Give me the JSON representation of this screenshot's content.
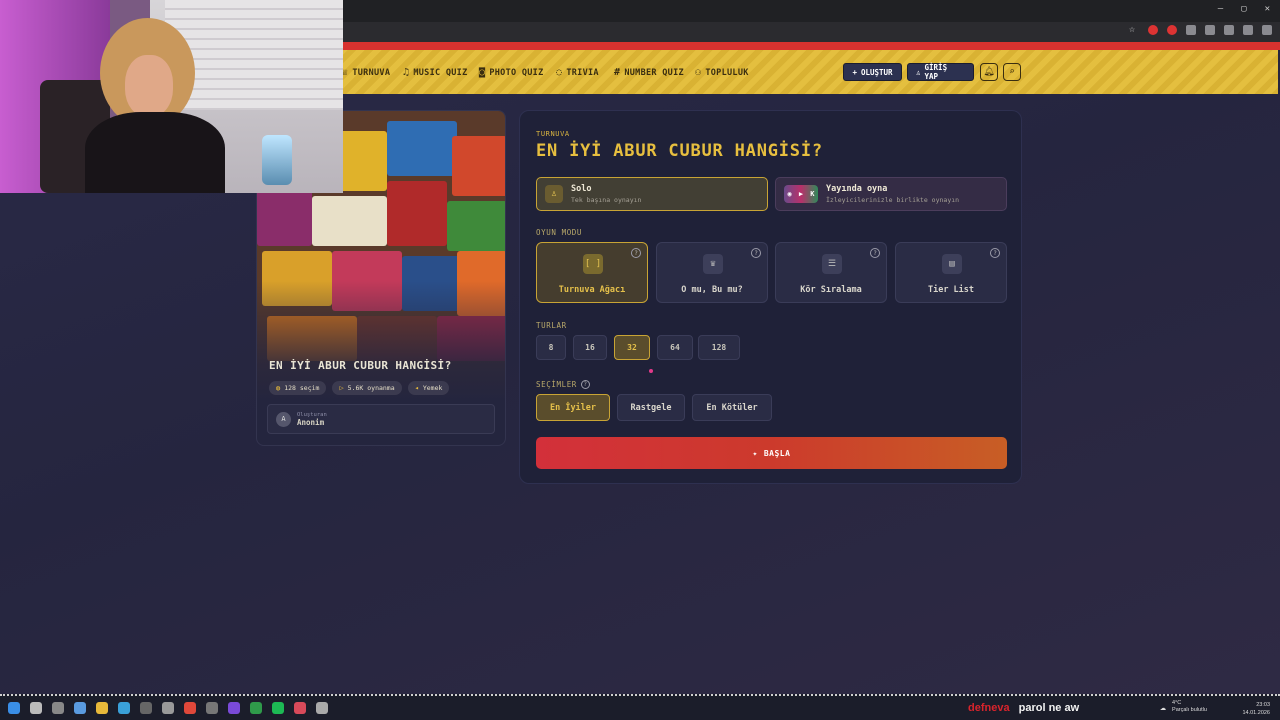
{
  "nav": {
    "items": [
      {
        "icon": "trophy-icon",
        "label": "TURNUVA"
      },
      {
        "icon": "music-icon",
        "label": "MUSIC QUIZ"
      },
      {
        "icon": "camera-icon",
        "label": "PHOTO QUIZ"
      },
      {
        "icon": "chat-icon",
        "label": "TRIVIA"
      },
      {
        "icon": "hash-icon",
        "label": "NUMBER QUIZ"
      },
      {
        "icon": "users-icon",
        "label": "TOPLULUK"
      }
    ],
    "create_label": "OLUŞTUR",
    "login_label": "GİRİŞ YAP"
  },
  "card": {
    "title": "EN İYİ ABUR CUBUR HANGİSİ?",
    "choices": "128 seçim",
    "plays": "5.6K oynanma",
    "category": "Yemek",
    "creator_label": "Oluşturan",
    "creator_initial": "A",
    "creator_name": "Anonim"
  },
  "panel": {
    "kicker": "TURNUVA",
    "title": "EN İYİ ABUR CUBUR HANGİSİ?",
    "solo": {
      "title": "Solo",
      "subtitle": "Tek başına oynayın"
    },
    "live": {
      "title": "Yayında oyna",
      "subtitle": "İzleyicilerinizle birlikte oynayın"
    },
    "game_mode_label": "OYUN MODU",
    "game_modes": [
      "Turnuva Ağacı",
      "O mu, Bu mu?",
      "Kör Sıralama",
      "Tier List"
    ],
    "rounds_label": "TURLAR",
    "rounds": [
      "8",
      "16",
      "32",
      "64",
      "128"
    ],
    "selected_round": "32",
    "selections_label": "SEÇİMLER",
    "selections": [
      "En İyiler",
      "Rastgele",
      "En Kötüler"
    ],
    "start_label": "BAŞLA"
  },
  "taskbar": {
    "stream_user": "defneva",
    "stream_msg": "parol ne aw",
    "weather_temp": "4°C",
    "weather_desc": "Parçalı bulutlu",
    "time": "23:03",
    "date": "14.01.2026"
  },
  "colors": {
    "accent": "#e4bf3f",
    "start": "#d3303a",
    "panel": "#1f2138"
  }
}
